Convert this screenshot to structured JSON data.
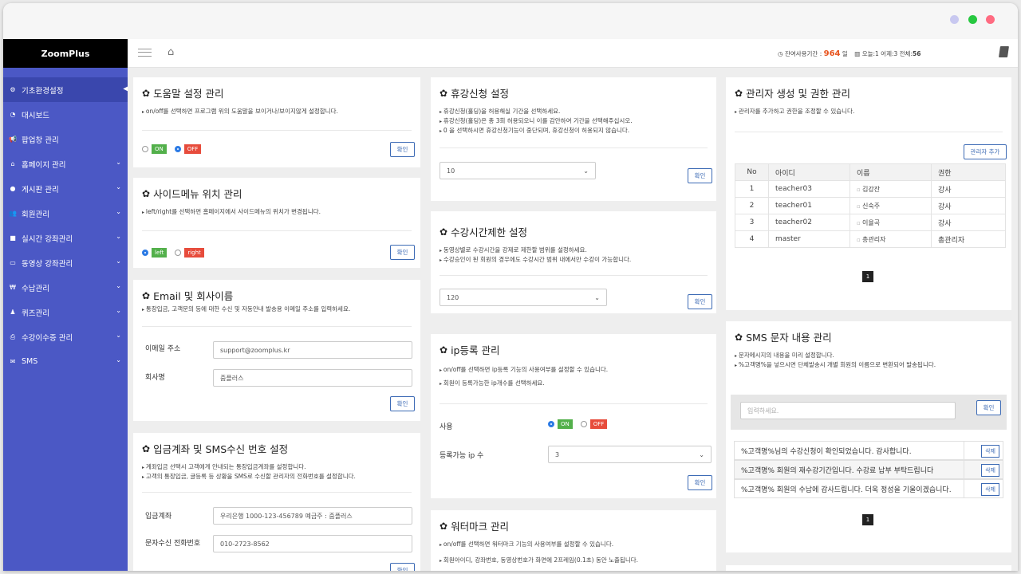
{
  "brand": "ZoomPlus",
  "window_dots": [
    "#c8c8f0",
    "#27c840",
    "#ff6b81"
  ],
  "topbar": {
    "stats_label": "잔여사용기간 :",
    "days": "964",
    "days_unit": "일",
    "stats_tail": "오늘:1  어제:3  전체:",
    "total": "56"
  },
  "sidebar": {
    "items": [
      {
        "label": "기초환경설정",
        "icon": "gears-icon"
      },
      {
        "label": "대시보드",
        "icon": "dashboard-icon"
      },
      {
        "label": "팝업창 관리",
        "icon": "bullhorn-icon"
      },
      {
        "label": "홈페이지 관리",
        "icon": "home-icon"
      },
      {
        "label": "게시판 관리",
        "icon": "comments-icon"
      },
      {
        "label": "회원관리",
        "icon": "users-icon"
      },
      {
        "label": "실시간 강좌관리",
        "icon": "video-icon"
      },
      {
        "label": "동영상 강좌관리",
        "icon": "monitor-icon"
      },
      {
        "label": "수납관리",
        "icon": "won-icon"
      },
      {
        "label": "퀴즈관리",
        "icon": "quiz-icon"
      },
      {
        "label": "수강이수증 관리",
        "icon": "print-icon"
      },
      {
        "label": "SMS",
        "icon": "mail-icon"
      }
    ]
  },
  "help": {
    "title": "도움말 설정 관리",
    "desc": "on/off를 선택하면 프로그램 위의 도움말을 보이거나/보이지않게 설정합니다.",
    "on": "ON",
    "off": "OFF",
    "confirm": "확인"
  },
  "sidemenu": {
    "title": "사이드메뉴 위치 관리",
    "desc": "left/right를 선택하면 홈페이지에서 사이드메뉴의 위치가 변경됩니다.",
    "left": "left",
    "right": "right",
    "confirm": "확인"
  },
  "email": {
    "title": "Email 및 회사이름",
    "desc": "통장입금, 고객문의 등에 대한 수신 및 자동안내 발송용 이메일 주소를 입력하세요.",
    "email_label": "이메일 주소",
    "email_value": "support@zoomplus.kr",
    "company_label": "회사명",
    "company_value": "줌플러스",
    "confirm": "확인"
  },
  "bank": {
    "title": "입금계좌 및 SMS수신 번호 설정",
    "desc1": "계좌입금 선택시 고객에게 안내되는 통장입금계좌를 설정합니다.",
    "desc2": "고객의 통장입금, 글등록 등 상황을 SMS로 수신할 관리자의 전화번호를 설정합니다.",
    "account_label": "입금계좌",
    "account_value": "우리은행 1000-123-456789 예금주 : 줌플러스",
    "phone_label": "문자수신 전화번호",
    "phone_value": "010-2723-8562",
    "confirm": "확인"
  },
  "leave": {
    "title": "휴강신청 설정",
    "desc1": "휴강신청(홀딩)을 허용해실 기간을 선택하세요.",
    "desc2": "휴강신청(홀딩)은 총 3회 허용되오니 이를 감안하여 기간을 선택해주십시오.",
    "desc3": "0 을 선택하시면 휴강신청기능이 중단되며, 휴강신청이 허용되지 않습니다.",
    "value": "10",
    "confirm": "확인"
  },
  "limit": {
    "title": "수강시간제한 설정",
    "desc1": "동영상별로 수강시간을 강제로 제한할 범위를 설정하세요.",
    "desc2": "수강승인이 된 회원의 경우에도 수강시간 범위 내에서만 수강이 가능합니다.",
    "value": "120",
    "confirm": "확인"
  },
  "ip": {
    "title": "ip등록 관리",
    "desc1": "on/off를 선택하면 ip등록 기능의 사용여부를 설정할 수 있습니다.",
    "desc2": "회원이 등록가능한 ip개수를 선택하세요.",
    "use_label": "사용",
    "on": "ON",
    "off": "OFF",
    "count_label": "등록가능 ip 수",
    "count_value": "3",
    "confirm": "확인"
  },
  "watermark": {
    "title": "워터마크 관리",
    "desc1": "on/off를 선택하면 워터마크 기능의 사용여부를 설정할 수 있습니다.",
    "desc2": "회원아이디, 강좌번호, 동영상번호가 화면에 2프레임(0.1초) 동안 노출됩니다."
  },
  "admin": {
    "title": "관리자 생성 및 권한 관리",
    "desc": "관리자를 추가하고 권한을 조정할 수 있습니다.",
    "add": "관리자 추가",
    "headers": [
      "No",
      "아이디",
      "이름",
      "권한"
    ],
    "rows": [
      {
        "no": "1",
        "id": "teacher03",
        "name": "김강잔",
        "role": "강사"
      },
      {
        "no": "2",
        "id": "teacher01",
        "name": "신숙주",
        "role": "강사"
      },
      {
        "no": "3",
        "id": "teacher02",
        "name": "이율곡",
        "role": "강사"
      },
      {
        "no": "4",
        "id": "master",
        "name": "총관리자",
        "role": "총관리자"
      }
    ],
    "page": "1"
  },
  "sms": {
    "title": "SMS 문자 내용 관리",
    "desc1": "문자메시지의 내용을 미리 설정합니다.",
    "desc2": "%고객명%을 넣으시면 단체발송시 개별 회원의 이름으로 변환되어 발송됩니다.",
    "placeholder": "입력하세요.",
    "confirm": "확인",
    "messages": [
      "%고객명%님의 수강신청이 확인되었습니다. 감사합니다.",
      "%고객명% 회원의 재수강기간입니다. 수강료 납부 부탁드립니다",
      "%고객명% 회원의 수납에 감사드립니다. 더욱 정성을 기울이겠습니다."
    ],
    "delete": "삭제",
    "page": "1"
  }
}
